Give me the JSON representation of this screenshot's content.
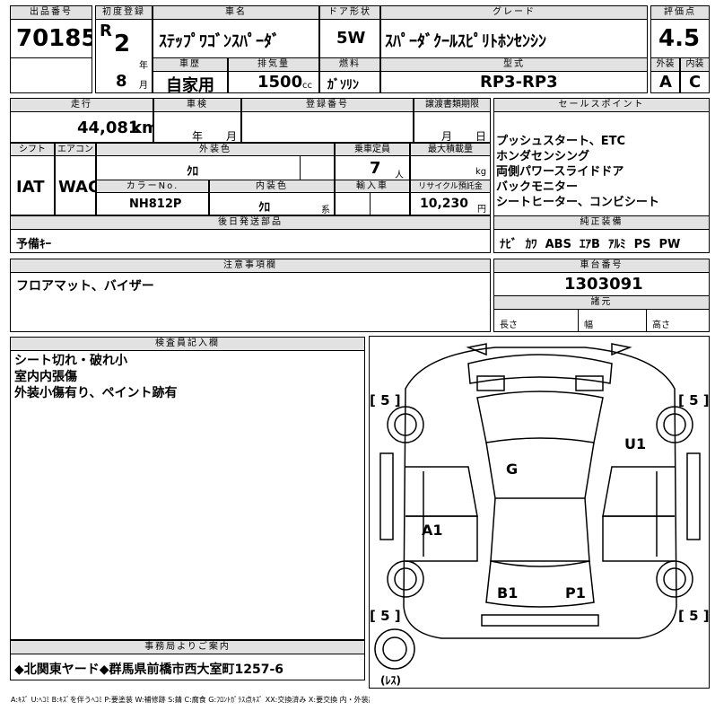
{
  "header": {
    "lot_label": "出品番号",
    "lot": "70185",
    "reg_label": "初度登録",
    "era": "R",
    "year": "2",
    "year_unit": "年",
    "month": "8",
    "month_unit": "月",
    "car_label": "車名",
    "car_name": "ｽﾃｯﾌﾟﾜｺﾞﾝｽﾊﾟｰﾀﾞ",
    "door_label": "ドア形状",
    "door": "5W",
    "grade_label": "グレード",
    "grade": "ｽﾊﾟｰﾀﾞｸｰﾙｽﾋﾟﾘﾄﾎﾝｾﾝｼﾝ",
    "score_label": "評価点",
    "score": "4.5",
    "history_label": "車歴",
    "history": "自家用",
    "disp_label": "排気量",
    "displacement": "1500",
    "disp_unit": "cc",
    "fuel_label": "燃料",
    "fuel": "ｶﾞｿﾘﾝ",
    "model_label": "型式",
    "model": "RP3-RP3",
    "ext_label": "外装",
    "ext_grade": "A",
    "int_label": "内装",
    "int_grade": "C"
  },
  "row2": {
    "mileage_label": "走行",
    "mileage": "44,081",
    "mileage_unit": "km",
    "inspection_label": "車検",
    "year_unit": "年",
    "month_unit": "月",
    "regno_label": "登録番号",
    "transfer_label": "譲渡書類期限",
    "t_month": "月",
    "t_day": "日",
    "shift_label": "シフト",
    "shift": "IAT",
    "ac_label": "エアコン",
    "ac": "WAC",
    "color_label": "外装色",
    "color": "ｸﾛ",
    "capacity_label": "乗車定員",
    "capacity": "7",
    "capacity_unit": "人",
    "load_label": "最大積載量",
    "load_unit": "kg",
    "colorno_label": "カラーNo.",
    "color_no": "NH812P",
    "intcolor_label": "内装色",
    "int_color": "ｸﾛ",
    "int_color_unit": "系",
    "import_label": "輸入車",
    "recycle_label": "リサイクル預託金",
    "recycle": "10,230",
    "recycle_unit": "円",
    "later_label": "後日発送部品",
    "later": "予備ｷｰ"
  },
  "sales": {
    "label": "セールスポイント",
    "points": [
      "プッシュスタート、ETC",
      "ホンダセンシング",
      "両側パワースライドドア",
      "バックモニター",
      "シートヒーター、コンビシート"
    ],
    "equip_label": "純正装備",
    "equip": [
      "ﾅﾋﾞ",
      "ｶﾜ",
      "ABS",
      "ｴｱB",
      "ｱﾙﾐ",
      "PS",
      "PW"
    ]
  },
  "notes": {
    "label": "注意事項欄",
    "text": "フロアマット、バイザー"
  },
  "frame": {
    "label": "車台番号",
    "number": "1303091",
    "spec_label": "諸元",
    "length": "長さ",
    "width": "幅",
    "height": "高さ"
  },
  "inspector": {
    "label": "検査員記入欄",
    "lines": [
      "シート切れ・破れ小",
      "室内内張傷",
      "外装小傷有り、ペイント跡有"
    ]
  },
  "office": {
    "label": "事務局よりご案内",
    "text": "◆北関東ヤード◆群馬県前橋市西大室町1257-6"
  },
  "diagram": {
    "tread_fl": "[ 5 ]",
    "tread_fr": "[ 5 ]",
    "tread_rl": "[ 5 ]",
    "tread_rr": "[ 5 ]",
    "mark_u1": "U1",
    "mark_g": "G",
    "mark_a1": "A1",
    "mark_b1": "B1",
    "mark_p1": "P1",
    "spare": "(ﾚｽ)"
  },
  "legend": "A:ｷｽﾞ U:ﾍｺﾐ B:ｷｽﾞを伴うﾍｺﾐ P:要塗装 W:補修跡 S:錆 C:腐食 G:ﾌﾛﾝﾄｶﾞﾗｽ点ｷｽﾞ XX:交換済み X:要交換 内・外装評価 5段階ﾗﾝｸ順(A・B・C・D・E) 2"
}
